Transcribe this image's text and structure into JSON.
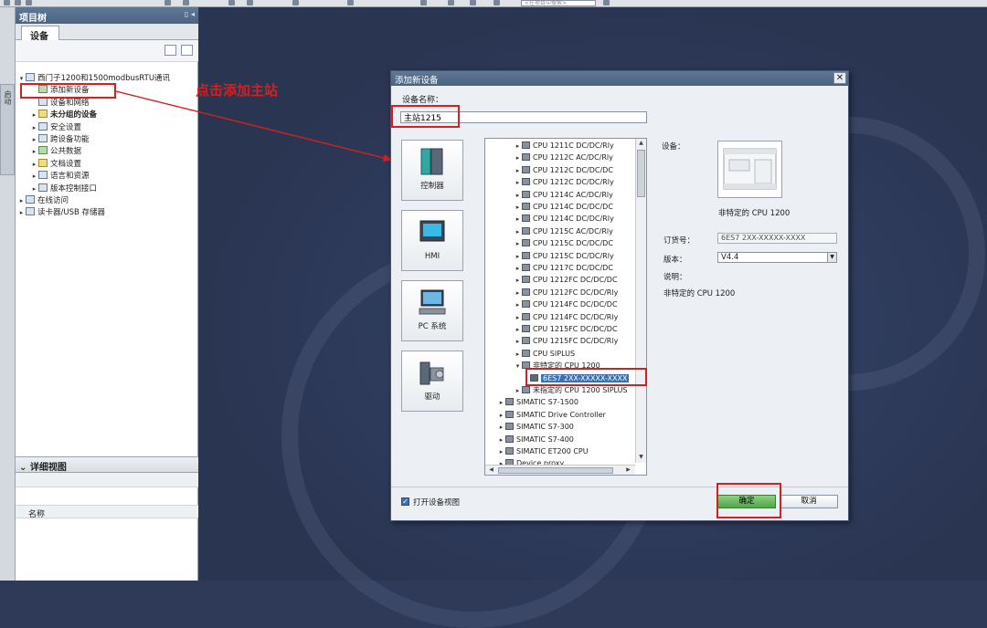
{
  "toolbar": {
    "search_placeholder": "<在项目中搜索>"
  },
  "left_strip": {
    "tab_label": "启动"
  },
  "project_tree": {
    "title": "项目树",
    "header_buttons": "▯ ◂",
    "tab_devices": "设备",
    "items": [
      {
        "toggle": "▾",
        "label": "西门子1200和1500modbusRTU通讯",
        "icon": "project-icon",
        "bold": false
      },
      {
        "toggle": "",
        "label": "添加新设备",
        "icon": "add-device-icon",
        "bold": false
      },
      {
        "toggle": "",
        "label": "设备和网络",
        "icon": "network-icon",
        "bold": false
      },
      {
        "toggle": "▸",
        "label": "未分组的设备",
        "icon": "folder-icon",
        "bold": true
      },
      {
        "toggle": "▸",
        "label": "安全设置",
        "icon": "security-icon",
        "bold": false
      },
      {
        "toggle": "▸",
        "label": "跨设备功能",
        "icon": "function-icon",
        "bold": false
      },
      {
        "toggle": "▸",
        "label": "公共数据",
        "icon": "folder-icon",
        "bold": false
      },
      {
        "toggle": "▸",
        "label": "文档设置",
        "icon": "document-icon",
        "bold": false
      },
      {
        "toggle": "▸",
        "label": "语言和资源",
        "icon": "language-icon",
        "bold": false
      },
      {
        "toggle": "▸",
        "label": "版本控制接口",
        "icon": "version-icon",
        "bold": false
      },
      {
        "toggle": "▸",
        "label": "在线访问",
        "icon": "online-icon",
        "bold": false
      },
      {
        "toggle": "▸",
        "label": "读卡器/USB 存储器",
        "icon": "card-reader-icon",
        "bold": false
      }
    ],
    "detail_view": {
      "title": "详细视图",
      "toggle": "⌄",
      "column_name": "名称"
    }
  },
  "annotation": {
    "text": "点击添加主站",
    "color": "#d42020"
  },
  "dialog": {
    "title": "添加新设备",
    "close": "✕",
    "device_name_label": "设备名称：",
    "device_name_value": "主站1215",
    "categories": [
      {
        "label": "控制器",
        "icon": "controller-icon"
      },
      {
        "label": "HMI",
        "icon": "hmi-icon"
      },
      {
        "label": "PC 系统",
        "icon": "pc-icon"
      },
      {
        "label": "驱动",
        "icon": "drive-icon"
      }
    ],
    "catalog": [
      {
        "indent": 3,
        "toggle": "▸",
        "label": "CPU 1211C DC/DC/Rly"
      },
      {
        "indent": 3,
        "toggle": "▸",
        "label": "CPU 1212C AC/DC/Rly"
      },
      {
        "indent": 3,
        "toggle": "▸",
        "label": "CPU 1212C DC/DC/DC"
      },
      {
        "indent": 3,
        "toggle": "▸",
        "label": "CPU 1212C DC/DC/Rly"
      },
      {
        "indent": 3,
        "toggle": "▸",
        "label": "CPU 1214C AC/DC/Rly"
      },
      {
        "indent": 3,
        "toggle": "▸",
        "label": "CPU 1214C DC/DC/DC"
      },
      {
        "indent": 3,
        "toggle": "▸",
        "label": "CPU 1214C DC/DC/Rly"
      },
      {
        "indent": 3,
        "toggle": "▸",
        "label": "CPU 1215C AC/DC/Rly"
      },
      {
        "indent": 3,
        "toggle": "▸",
        "label": "CPU 1215C DC/DC/DC"
      },
      {
        "indent": 3,
        "toggle": "▸",
        "label": "CPU 1215C DC/DC/Rly"
      },
      {
        "indent": 3,
        "toggle": "▸",
        "label": "CPU 1217C DC/DC/DC"
      },
      {
        "indent": 3,
        "toggle": "▸",
        "label": "CPU 1212FC DC/DC/DC"
      },
      {
        "indent": 3,
        "toggle": "▸",
        "label": "CPU 1212FC DC/DC/Rly"
      },
      {
        "indent": 3,
        "toggle": "▸",
        "label": "CPU 1214FC DC/DC/DC"
      },
      {
        "indent": 3,
        "toggle": "▸",
        "label": "CPU 1214FC DC/DC/Rly"
      },
      {
        "indent": 3,
        "toggle": "▸",
        "label": "CPU 1215FC DC/DC/DC"
      },
      {
        "indent": 3,
        "toggle": "▸",
        "label": "CPU 1215FC DC/DC/Rly"
      },
      {
        "indent": 3,
        "toggle": "▸",
        "label": "CPU SIPLUS"
      },
      {
        "indent": 3,
        "toggle": "▾",
        "label": "非特定的 CPU 1200"
      },
      {
        "indent": 4,
        "toggle": "",
        "label": "6ES7 2XX-XXXXX-XXXX",
        "selected": true
      },
      {
        "indent": 3,
        "toggle": "▸",
        "label": "未指定的 CPU 1200 SIPLUS"
      },
      {
        "indent": 1,
        "toggle": "▸",
        "label": "SIMATIC S7-1500"
      },
      {
        "indent": 1,
        "toggle": "▸",
        "label": "SIMATIC Drive Controller"
      },
      {
        "indent": 1,
        "toggle": "▸",
        "label": "SIMATIC S7-300"
      },
      {
        "indent": 1,
        "toggle": "▸",
        "label": "SIMATIC S7-400"
      },
      {
        "indent": 1,
        "toggle": "▸",
        "label": "SIMATIC ET200 CPU"
      },
      {
        "indent": 1,
        "toggle": "▸",
        "label": "Device proxy"
      }
    ],
    "device_label": "设备：",
    "device_caption": "非特定的 CPU 1200",
    "order_label": "订货号：",
    "order_value": "6ES7 2XX-XXXXX-XXXX",
    "version_label": "版本：",
    "version_value": "V4.4",
    "description_label": "说明：",
    "description_text": "非特定的 CPU 1200",
    "open_view_label": "打开设备视图",
    "ok_label": "确定",
    "cancel_label": "取消"
  },
  "colors": {
    "accent_red": "#d42020",
    "selection_blue": "#3c6fb5",
    "ok_green": "#52a54a"
  }
}
